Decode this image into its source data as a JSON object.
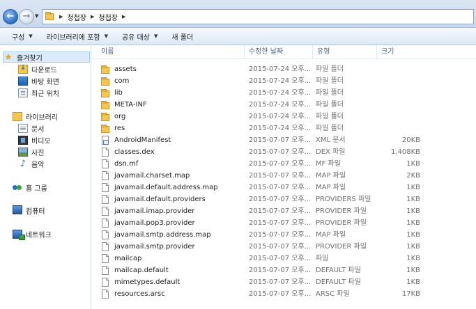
{
  "address": {
    "path": [
      "청첩장",
      "청첩장"
    ]
  },
  "toolbar": {
    "organize": "구성",
    "include_library": "라이브러리에 포함",
    "share": "공유 대상",
    "new_folder": "새 폴더"
  },
  "nav": {
    "favorites": "즐겨찾기",
    "downloads": "다운로드",
    "desktop": "바탕 화면",
    "recent": "최근 위치",
    "libraries": "라이브러리",
    "documents": "문서",
    "videos": "비디오",
    "pictures": "사진",
    "music": "음악",
    "homegroup": "홈 그룹",
    "computer": "컴퓨터",
    "network": "네트워크"
  },
  "columns": {
    "name": "이름",
    "modified": "수정한 날짜",
    "type": "유형",
    "size": "크기"
  },
  "files": [
    {
      "name": "assets",
      "date": "2015-07-24 오후...",
      "type": "파일 폴더",
      "size": "",
      "icon": "folder"
    },
    {
      "name": "com",
      "date": "2015-07-24 오후...",
      "type": "파일 폴더",
      "size": "",
      "icon": "folder"
    },
    {
      "name": "lib",
      "date": "2015-07-24 오후...",
      "type": "파일 폴더",
      "size": "",
      "icon": "folder"
    },
    {
      "name": "META-INF",
      "date": "2015-07-24 오후...",
      "type": "파일 폴더",
      "size": "",
      "icon": "folder"
    },
    {
      "name": "org",
      "date": "2015-07-24 오후...",
      "type": "파일 폴더",
      "size": "",
      "icon": "folder"
    },
    {
      "name": "res",
      "date": "2015-07-24 오후...",
      "type": "파일 폴더",
      "size": "",
      "icon": "folder"
    },
    {
      "name": "AndroidManifest",
      "date": "2015-07-07 오후...",
      "type": "XML 문서",
      "size": "20KB",
      "icon": "xml"
    },
    {
      "name": "classes.dex",
      "date": "2015-07-07 오후...",
      "type": "DEX 파일",
      "size": "1,408KB",
      "icon": "file"
    },
    {
      "name": "dsn.mf",
      "date": "2015-07-07 오후...",
      "type": "MF 파일",
      "size": "1KB",
      "icon": "file"
    },
    {
      "name": "javamail.charset.map",
      "date": "2015-07-07 오후...",
      "type": "MAP 파일",
      "size": "2KB",
      "icon": "file"
    },
    {
      "name": "javamail.default.address.map",
      "date": "2015-07-07 오후...",
      "type": "MAP 파일",
      "size": "1KB",
      "icon": "file"
    },
    {
      "name": "javamail.default.providers",
      "date": "2015-07-07 오후...",
      "type": "PROVIDERS 파일",
      "size": "1KB",
      "icon": "file"
    },
    {
      "name": "javamail.imap.provider",
      "date": "2015-07-07 오후...",
      "type": "PROVIDER 파일",
      "size": "1KB",
      "icon": "file"
    },
    {
      "name": "javamail.pop3.provider",
      "date": "2015-07-07 오후...",
      "type": "PROVIDER 파일",
      "size": "1KB",
      "icon": "file"
    },
    {
      "name": "javamail.smtp.address.map",
      "date": "2015-07-07 오후...",
      "type": "MAP 파일",
      "size": "1KB",
      "icon": "file"
    },
    {
      "name": "javamail.smtp.provider",
      "date": "2015-07-07 오후...",
      "type": "PROVIDER 파일",
      "size": "1KB",
      "icon": "file"
    },
    {
      "name": "mailcap",
      "date": "2015-07-07 오후...",
      "type": "파일",
      "size": "1KB",
      "icon": "file"
    },
    {
      "name": "mailcap.default",
      "date": "2015-07-07 오후...",
      "type": "DEFAULT 파일",
      "size": "1KB",
      "icon": "file"
    },
    {
      "name": "mimetypes.default",
      "date": "2015-07-07 오후...",
      "type": "DEFAULT 파일",
      "size": "1KB",
      "icon": "file"
    },
    {
      "name": "resources.arsc",
      "date": "2015-07-07 오후...",
      "type": "ARSC 파일",
      "size": "17KB",
      "icon": "file"
    }
  ]
}
